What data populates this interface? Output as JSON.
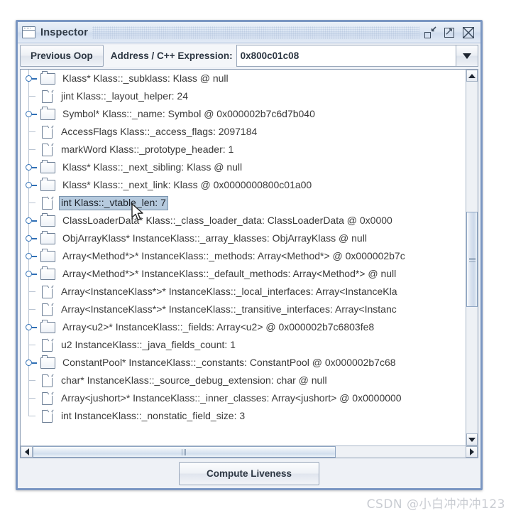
{
  "window": {
    "title": "Inspector",
    "icon": "window-icon",
    "controls": [
      {
        "name": "restore-button",
        "glyph": "restore"
      },
      {
        "name": "maximize-button",
        "glyph": "maximize"
      },
      {
        "name": "close-button",
        "glyph": "close"
      }
    ]
  },
  "toolbar": {
    "previous_oop_label": "Previous Oop",
    "address_label": "Address / C++ Expression:",
    "address_value": "0x800c01c08",
    "address_placeholder": "",
    "dropdown_icon": "chevron-down-icon"
  },
  "tree": {
    "rows": [
      {
        "expandable": true,
        "selected": false,
        "label": "Klass* Klass::_subklass: Klass @ null"
      },
      {
        "expandable": false,
        "selected": false,
        "label": "jint Klass::_layout_helper: 24"
      },
      {
        "expandable": true,
        "selected": false,
        "label": "Symbol* Klass::_name: Symbol @ 0x000002b7c6d7b040"
      },
      {
        "expandable": false,
        "selected": false,
        "label": "AccessFlags Klass::_access_flags: 2097184"
      },
      {
        "expandable": false,
        "selected": false,
        "label": "markWord Klass::_prototype_header: 1"
      },
      {
        "expandable": true,
        "selected": false,
        "label": "Klass* Klass::_next_sibling: Klass @ null"
      },
      {
        "expandable": true,
        "selected": false,
        "label": "Klass* Klass::_next_link: Klass @ 0x0000000800c01a00"
      },
      {
        "expandable": false,
        "selected": true,
        "label": "int Klass::_vtable_len: 7"
      },
      {
        "expandable": true,
        "selected": false,
        "label": "ClassLoaderData* Klass::_class_loader_data: ClassLoaderData @ 0x0000"
      },
      {
        "expandable": true,
        "selected": false,
        "label": "ObjArrayKlass* InstanceKlass::_array_klasses: ObjArrayKlass @ null"
      },
      {
        "expandable": true,
        "selected": false,
        "label": "Array<Method*>* InstanceKlass::_methods: Array<Method*> @ 0x000002b7c"
      },
      {
        "expandable": true,
        "selected": false,
        "label": "Array<Method*>* InstanceKlass::_default_methods: Array<Method*> @ null"
      },
      {
        "expandable": false,
        "selected": false,
        "label": "Array<InstanceKlass*>* InstanceKlass::_local_interfaces: Array<InstanceKla"
      },
      {
        "expandable": false,
        "selected": false,
        "label": "Array<InstanceKlass*>* InstanceKlass::_transitive_interfaces: Array<Instanc"
      },
      {
        "expandable": true,
        "selected": false,
        "label": "Array<u2>* InstanceKlass::_fields: Array<u2> @ 0x000002b7c6803fe8"
      },
      {
        "expandable": false,
        "selected": false,
        "label": "u2 InstanceKlass::_java_fields_count: 1"
      },
      {
        "expandable": true,
        "selected": false,
        "label": "ConstantPool* InstanceKlass::_constants: ConstantPool @ 0x000002b7c68"
      },
      {
        "expandable": false,
        "selected": false,
        "label": "char* InstanceKlass::_source_debug_extension: char @ null"
      },
      {
        "expandable": false,
        "selected": false,
        "label": "Array<jushort>* InstanceKlass::_inner_classes: Array<jushort> @ 0x0000000"
      },
      {
        "expandable": false,
        "selected": false,
        "label": "int InstanceKlass::_nonstatic_field_size: 3"
      }
    ]
  },
  "scrollbars": {
    "vertical": {
      "up_icon": "triangle-up-icon",
      "down_icon": "triangle-down-icon",
      "thumb_top_pct": 37,
      "thumb_height_pct": 27
    },
    "horizontal": {
      "left_icon": "triangle-left-icon",
      "right_icon": "triangle-right-icon",
      "thumb_left_pct": 0,
      "thumb_width_pct": 70
    }
  },
  "footer": {
    "compute_liveness_label": "Compute Liveness"
  },
  "watermark": {
    "text": "CSDN @小白冲冲冲123"
  }
}
